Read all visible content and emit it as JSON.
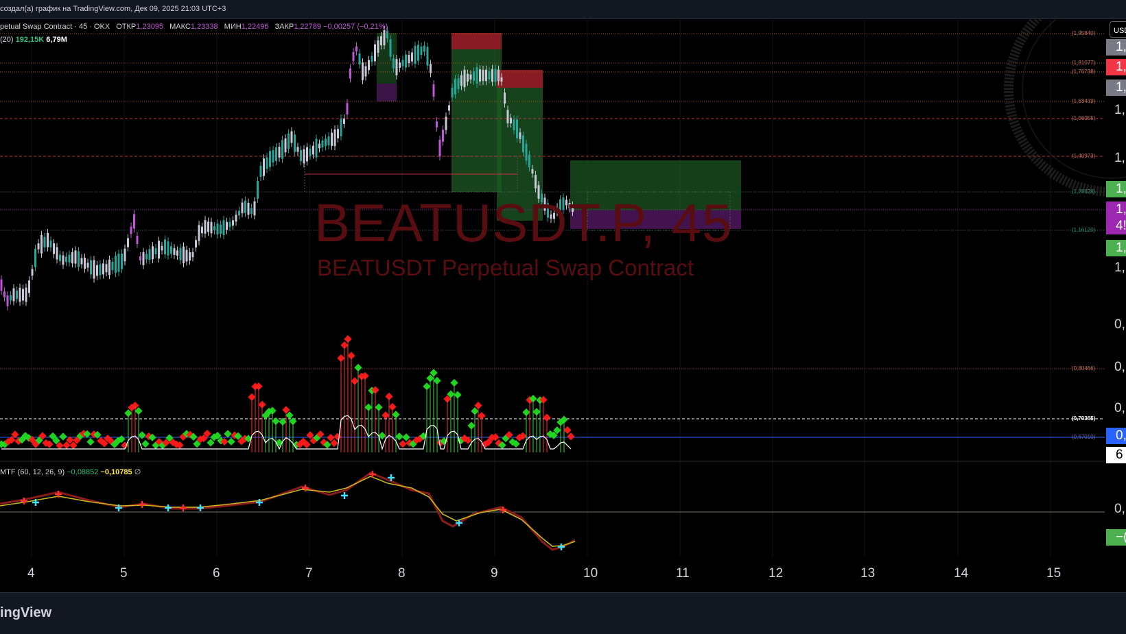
{
  "header": {
    "title": "создал(а) график на TradingView.com, Дек 09, 2025 21:03 UTC+3"
  },
  "legend": {
    "symbol": "petual Swap Contract · 45 · OKX",
    "open_label": "ОТКР",
    "open_value": "1,23095",
    "high_label": "МАКС",
    "high_value": "1,23338",
    "low_label": "МИН",
    "low_value": "1,22496",
    "close_label": "ЗАКР",
    "close_value": "1,22789",
    "change_value": "−0,00257 (−0,21%)",
    "volume_prefix": "(20)",
    "volume_value_1": "192,15K",
    "volume_value_2": "6,79M",
    "macd_label": "MTF (60, 12, 26, 9)",
    "macd_value_1": "−0,08852",
    "macd_value_2": "−0,10785",
    "macd_value_3": "∅"
  },
  "currency_button": "USD",
  "watermark": {
    "symbol": "BEATUSDT.P, 45",
    "description": "BEATUSDT Perpetual Swap Contract"
  },
  "time_axis": [
    "4",
    "5",
    "6",
    "7",
    "8",
    "9",
    "10",
    "11",
    "12",
    "13",
    "14",
    "15"
  ],
  "price_axis": [
    {
      "text": "1,",
      "bg": "#787b86"
    },
    {
      "text": "1,",
      "bg": "#f23645"
    },
    {
      "text": "1,",
      "bg": "#787b86"
    },
    {
      "text": "1,",
      "bg": ""
    },
    {
      "text": "1,",
      "bg": ""
    },
    {
      "text": "1,",
      "bg": "#4caf50"
    },
    {
      "text": "1,",
      "bg": "#9c27b0"
    },
    {
      "text": "4!",
      "bg": "#9c27b0"
    },
    {
      "text": "1,",
      "bg": "#4caf50"
    },
    {
      "text": "1,",
      "bg": ""
    },
    {
      "text": "0,",
      "bg": ""
    },
    {
      "text": "0,",
      "bg": ""
    },
    {
      "text": "0,",
      "bg": ""
    },
    {
      "text": "0,",
      "bg": "#2962ff"
    },
    {
      "text": "6",
      "bg": "#ffffff"
    },
    {
      "text": "0,",
      "bg": ""
    },
    {
      "text": "−(",
      "bg": "#4caf50"
    }
  ],
  "level_labels": [
    "(1,95840)",
    "(1,81077)",
    "(1,76738)",
    "(1,63439)",
    "(1,56055)",
    "(1,40973)",
    "(1,28628)",
    "(1,16120)",
    "(0,80466)",
    "(0,70365)",
    "(0,67010)"
  ],
  "colors": {
    "up": "#26a69a",
    "down": "#ef5350",
    "purple": "#c155d9",
    "green_zone": "#1b5e20",
    "red_zone": "#8b1a1a"
  },
  "footer": {
    "brand": "ingView"
  }
}
